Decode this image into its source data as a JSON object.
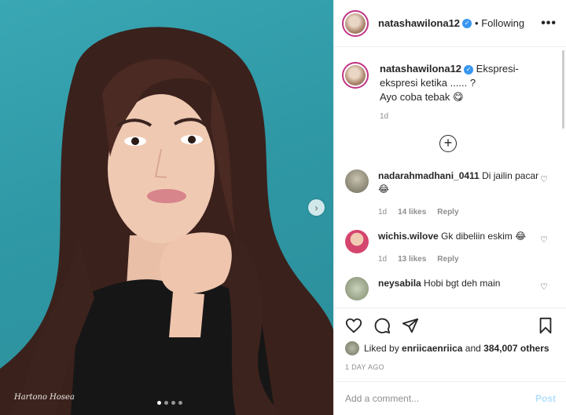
{
  "post": {
    "username": "natashawilona12",
    "follow_status": "• Following",
    "more_label": "•••",
    "caption_line1": "Ekspresi-ekspresi ketika ...... ?",
    "caption_line2": "Ayo coba tebak 😋",
    "caption_time": "1d",
    "load_more": "+"
  },
  "photo": {
    "watermark": "Hartono Hosea",
    "next_label": "›",
    "slide_count": 4,
    "active_slide": 1
  },
  "comments": [
    {
      "username": "nadarahmadhani_0411",
      "text": "Di jailin pacar😂",
      "time": "1d",
      "likes": "14 likes",
      "reply": "Reply"
    },
    {
      "username": "wichis.wilove",
      "text": "Gk dibeliin eskim 😂",
      "time": "1d",
      "likes": "13 likes",
      "reply": "Reply"
    },
    {
      "username": "neysabila",
      "text": "Hobi bgt deh main",
      "time": "",
      "likes": "",
      "reply": ""
    }
  ],
  "likes": {
    "prefix": "Liked by",
    "user": "enriicaenriica",
    "suffix": "and",
    "count": "384,007 others"
  },
  "time_ago": "1 DAY AGO",
  "add_comment": {
    "placeholder": "Add a comment...",
    "post_label": "Post"
  },
  "colors": {
    "verified": "#3897f0",
    "story_ring": "#c13584",
    "post_disabled": "#b2dffc",
    "photo_bg": "#3aa7b4"
  },
  "icons": {
    "like": "heart-icon",
    "comment": "comment-icon",
    "share": "paper-plane-icon",
    "save": "bookmark-icon"
  }
}
